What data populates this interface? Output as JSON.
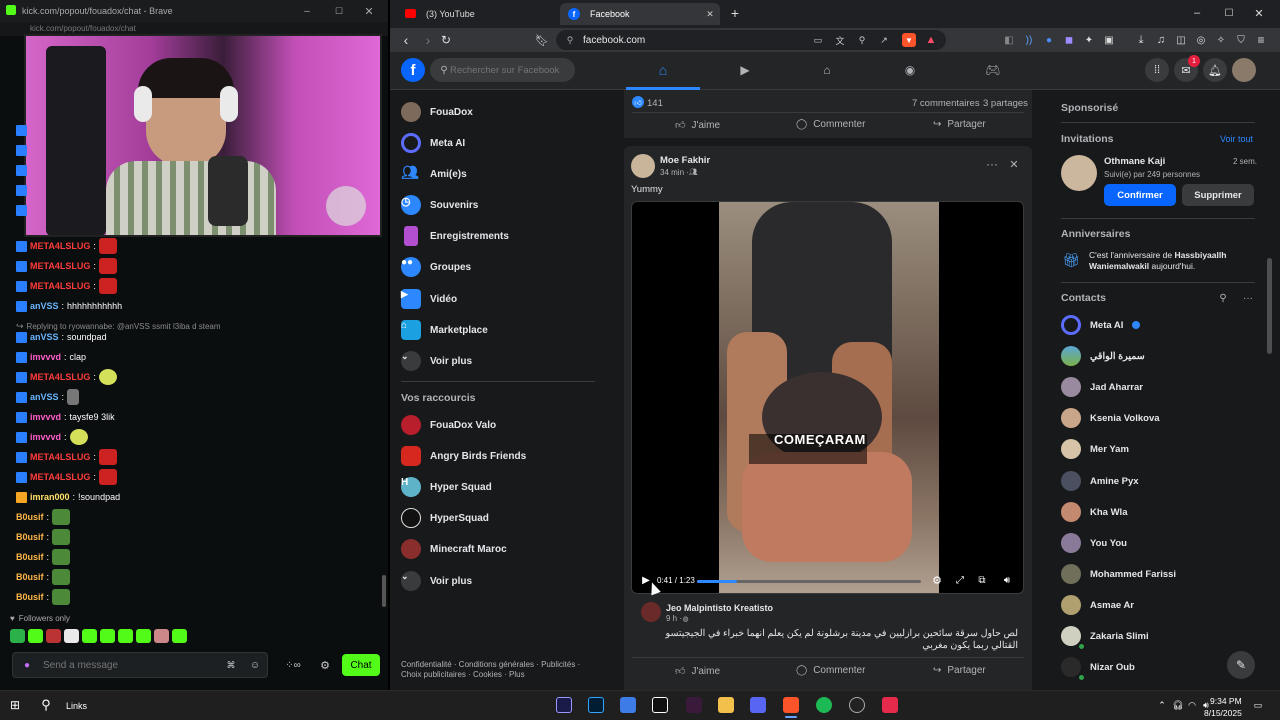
{
  "kick": {
    "window_title": "kick.com/popout/fouadox/chat - Brave",
    "url_partial": "kick.com/popout/fouadox/chat",
    "messages": [
      {
        "user": "META4LSLUG",
        "sep": ":",
        "text": "",
        "color": "red"
      },
      {
        "user": "META4LSLUG",
        "sep": ":",
        "text": "",
        "color": "red"
      },
      {
        "user": "META4LSLUG",
        "sep": ":",
        "text": "",
        "color": "red"
      },
      {
        "user": "anVSS",
        "sep": ":",
        "text": "hhhhhhhhhhh",
        "color": "blue"
      },
      {
        "reply": "Replying to ryowannabe: @anVSS ssmit l3iba d steam"
      },
      {
        "user": "anVSS",
        "sep": ":",
        "text": "soundpad",
        "color": "blue"
      },
      {
        "user": "imvvvd",
        "sep": ":",
        "text": "clap",
        "color": "pink"
      },
      {
        "user": "META4LSLUG",
        "sep": ":",
        "text": "",
        "color": "red"
      },
      {
        "user": "anVSS",
        "sep": ":",
        "text": "",
        "color": "blue"
      },
      {
        "user": "imvvvd",
        "sep": ":",
        "text": "taysfe9 3lik",
        "color": "pink"
      },
      {
        "user": "imvvvd",
        "sep": ":",
        "text": "",
        "color": "pink"
      },
      {
        "user": "META4LSLUG",
        "sep": ":",
        "text": "",
        "color": "red"
      },
      {
        "user": "META4LSLUG",
        "sep": ":",
        "text": "",
        "color": "red"
      },
      {
        "user": "imran000",
        "sep": ":",
        "text": "!soundpad",
        "color": "yellow"
      },
      {
        "user": "B0usif",
        "sep": ":",
        "text": "",
        "color": "orange"
      },
      {
        "user": "B0usif",
        "sep": ":",
        "text": "",
        "color": "orange"
      },
      {
        "user": "B0usif",
        "sep": ":",
        "text": "",
        "color": "orange"
      },
      {
        "user": "B0usif",
        "sep": ":",
        "text": "",
        "color": "orange"
      },
      {
        "user": "B0usif",
        "sep": ":",
        "text": "",
        "color": "orange"
      }
    ],
    "followers_only": "Followers only",
    "send_placeholder": "Send a message",
    "chat_button": "Chat"
  },
  "browser": {
    "tabs": [
      {
        "label": "(3) YouTube"
      },
      {
        "label": "Facebook"
      }
    ],
    "address": "facebook.com"
  },
  "facebook": {
    "search_placeholder": "Rechercher sur Facebook",
    "notifications_count": "1",
    "left_nav": [
      {
        "label": "FouaDox"
      },
      {
        "label": "Meta AI"
      },
      {
        "label": "Ami(e)s"
      },
      {
        "label": "Souvenirs"
      },
      {
        "label": "Enregistrements"
      },
      {
        "label": "Groupes"
      },
      {
        "label": "Vidéo"
      },
      {
        "label": "Marketplace"
      },
      {
        "label": "Voir plus"
      }
    ],
    "shortcuts_title": "Vos raccourcis",
    "shortcuts": [
      {
        "label": "FouaDox Valo"
      },
      {
        "label": "Angry Birds Friends"
      },
      {
        "label": "Hyper Squad",
        "letter": "H"
      },
      {
        "label": "HyperSquad"
      },
      {
        "label": "Minecraft Maroc"
      },
      {
        "label": "Voir plus"
      }
    ],
    "footer_line1": "Confidentialité · Conditions générales · Publicités ·",
    "footer_line2": "Choix publicitaires · Cookies · Plus",
    "prev_post": {
      "likes": "141",
      "comments": "7 commentaires",
      "shares": "3 partages"
    },
    "actions": {
      "like": "J'aime",
      "comment": "Commenter",
      "share": "Partager"
    },
    "post": {
      "author": "Moe Fakhir",
      "time": "34 min ·",
      "text": "Yummy",
      "video_caption": "COMEÇARAM",
      "video_time": "0:41 / 1:23",
      "progress": 0.18,
      "shared_author": "Jeo Malpintisto Kreatisto",
      "shared_time": "9 h ·",
      "shared_text": "لص حاول سرقة سائحين برازليين في مدينة برشلونة لم يكن يعلم انهما خبراء في الجيجيتسو القتالي ربما يكون مغربي"
    },
    "right": {
      "sponsored": "Sponsorisé",
      "invitations_title": "Invitations",
      "see_all": "Voir tout",
      "invite_name": "Othmane Kaji",
      "invite_time": "2 sem.",
      "invite_sub": "Suivi(e) par 249 personnes",
      "confirm": "Confirmer",
      "delete": "Supprimer",
      "birthdays_title": "Anniversaires",
      "birthday_text": "C'est l'anniversaire de ",
      "birthday_name": "Hassbiyaallh Waniemalwakil",
      "birthday_suffix": " aujourd'hui.",
      "contacts_title": "Contacts",
      "contacts": [
        {
          "name": "Meta AI"
        },
        {
          "name": "سميرة الواقي"
        },
        {
          "name": "Jad Aharrar"
        },
        {
          "name": "Ksenia Volkova"
        },
        {
          "name": "Mer Yam"
        },
        {
          "name": "Amine Pyx"
        },
        {
          "name": "Kha Wla"
        },
        {
          "name": "You You"
        },
        {
          "name": "Mohammed Farissi"
        },
        {
          "name": "Asmae Ar"
        },
        {
          "name": "Zakaria Slimi"
        },
        {
          "name": "Nizar Oub"
        }
      ]
    }
  },
  "taskbar": {
    "links_label": "Links",
    "time": "9:34 PM",
    "date": "8/15/2025"
  },
  "colors": {
    "fb_blue": "#0866ff",
    "kick_green": "#53fc18",
    "fb_bg": "#18191a",
    "fb_card": "#242526"
  }
}
